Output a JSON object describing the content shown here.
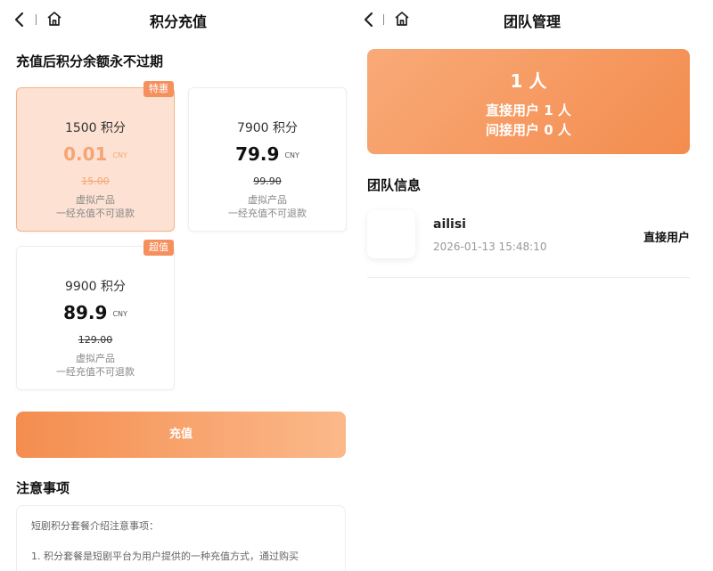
{
  "left": {
    "title": "积分充值",
    "section_title": "充值后积分余额永不过期",
    "packages": [
      {
        "badge": "特惠",
        "points": "1500 积分",
        "price": "0.01",
        "currency": "CNY",
        "original": "15.00",
        "desc1": "虚拟产品",
        "desc2": "一经充值不可退款",
        "selected": true
      },
      {
        "badge": "",
        "points": "7900 积分",
        "price": "79.9",
        "currency": "CNY",
        "original": "99.90",
        "desc1": "虚拟产品",
        "desc2": "一经充值不可退款",
        "selected": false
      },
      {
        "badge": "超值",
        "points": "9900 积分",
        "price": "89.9",
        "currency": "CNY",
        "original": "129.00",
        "desc1": "虚拟产品",
        "desc2": "一经充值不可退款",
        "selected": false
      }
    ],
    "recharge_label": "充值",
    "notes_title": "注意事项",
    "notes_intro": "短剧积分套餐介绍注意事项：",
    "notes_item1": "1. 积分套餐是短剧平台为用户提供的一种充值方式，通过购买"
  },
  "right": {
    "title": "团队管理",
    "total": "1 人",
    "direct": "直接用户 1 人",
    "indirect": "间接用户 0 人",
    "info_title": "团队信息",
    "members": [
      {
        "name": "ailisi",
        "time": "2026-01-13 15:48:10",
        "type": "直接用户"
      }
    ]
  },
  "colors": {
    "accent": "#f48d4f",
    "selected_bg": "#fde2d3",
    "badge": "#f5905e"
  }
}
